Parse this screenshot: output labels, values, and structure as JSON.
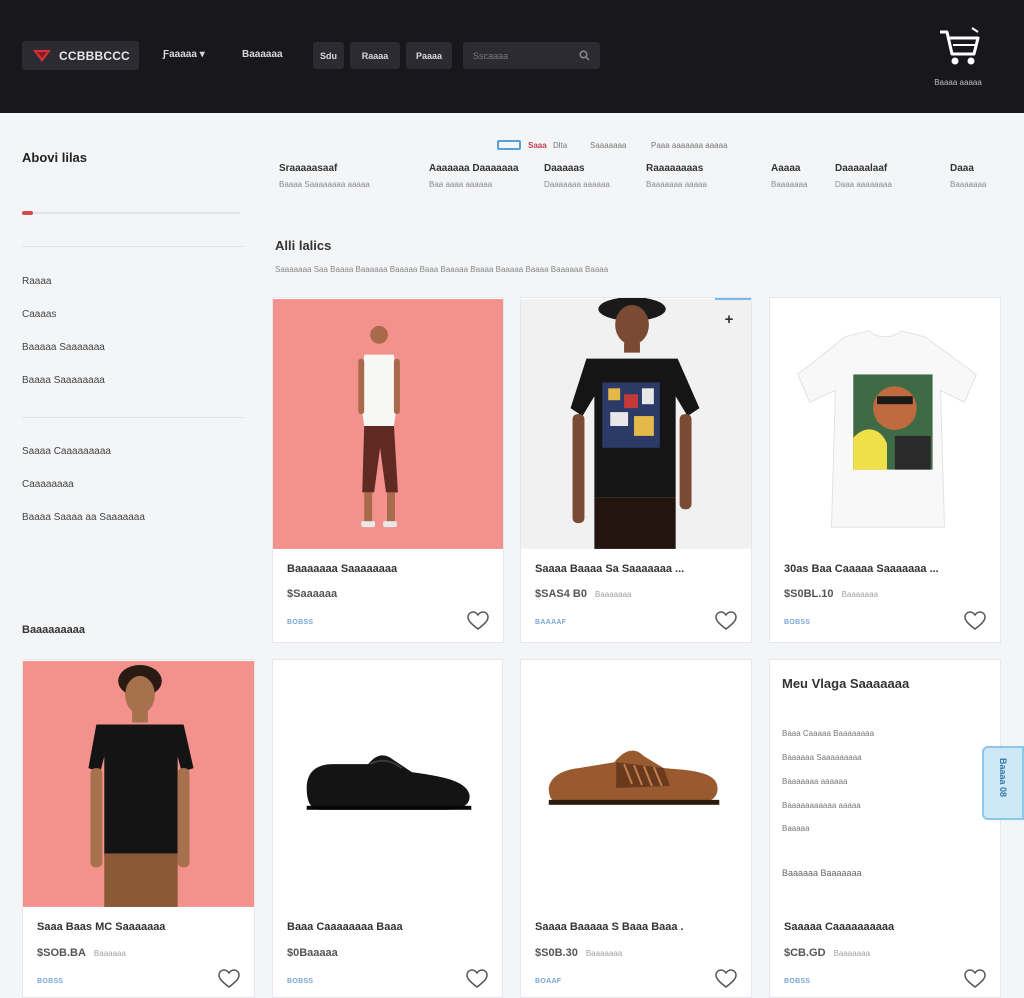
{
  "header": {
    "logo_text": "CCBBBCCC",
    "nav_links": [
      "Ƒaaaaa ▾",
      "Baaaaaa"
    ],
    "nav_buttons": [
      "Sdu",
      "Raaaa",
      "Paaaa"
    ],
    "search_placeholder": "Sscaaaa",
    "cart_label": "Baaaa aaaaa",
    "colors": {
      "bar": "#17171c",
      "accent": "#d24a4a"
    }
  },
  "sidebar": {
    "title": "Abovi lilas",
    "progress": 0.05,
    "group1": [
      "Raaaa",
      "Caaaas",
      "Baaaaa Saaaaaaa",
      "Baaaa Saaaaaaaa"
    ],
    "group2": [
      "Saaaa Caaaaaaaaa",
      "Caaaaaaaa",
      "Baaaa Saaaa aa Saaaaaaa"
    ],
    "heading": "Baaaaaaaaa"
  },
  "filters": {
    "top": [
      "Saaa",
      "Dlta",
      "Saaaaaaa",
      "Paaa  aaaaaaa aaaaa"
    ],
    "columns": [
      {
        "label": "Sraaaaasaaf",
        "sub": "Baaaa Saaaaaaaa aaaaa"
      },
      {
        "label": "Aaaaaaa Daaaaaaa",
        "sub": "Baa aaaa aaaaaa"
      },
      {
        "label": "Daaaaas",
        "sub": "Daaaaaaa aaaaaa"
      },
      {
        "label": "Raaaaaaaas",
        "sub": "Baaaaaaa aaaaa"
      },
      {
        "label": "Aaaaa",
        "sub": "Baaaaaaa"
      },
      {
        "label": "Daaaaalaaf",
        "sub": "Daaa aaaaaaaa"
      },
      {
        "label": "Daaa",
        "sub": "Baaaaaaa"
      }
    ]
  },
  "section": {
    "title": "Alli lalics",
    "description": "Saaaaaaa  Saa Baaaa Baaaaaa Baaaaa Baaa Baaaaa Baaaa Baaaaa Baaaa Baaaaaa Baaaa"
  },
  "products": [
    {
      "name": "Baaaaaaa Saaaaaaaa",
      "price": "$Saaaaaa",
      "old": "",
      "tag": "BOBSS",
      "bg": "#f3918d"
    },
    {
      "name": "Saaaa Baaaa Sa Saaaaaaa ...",
      "price": "$SAS4 B0",
      "old": "Baaaaaaa",
      "tag": "BAAAAF",
      "bg": "#f1f1f1"
    },
    {
      "name": "30as Baa Caaaaa Saaaaaaa ...",
      "price": "$S0BL.10",
      "old": "Baaaaaaa",
      "tag": "BOBSS",
      "bg": "#ffffff"
    },
    {
      "name": "Saaa Baas MC Saaaaaaa",
      "price": "$SOB.BA",
      "old": "Baaaaaa",
      "tag": "BOBSS",
      "bg": "#f3918d"
    },
    {
      "name": "Baaa Caaaaaaaa Baaa",
      "price": "$0Baaaaa",
      "old": "",
      "tag": "BOBSS",
      "bg": "#ffffff"
    },
    {
      "name": "Saaaa Baaaaa S Baaa Baaa .",
      "price": "$S0B.30",
      "old": "Baaaaaaa",
      "tag": "BOAAF",
      "bg": "#ffffff"
    },
    {
      "name": "Saaaaa Caaaaaaaaaa",
      "price": "$CB.GD",
      "old": "Baaaaaaa",
      "tag": "BOBSS",
      "bg": "#ffffff"
    }
  ],
  "info_card": {
    "title": "Meu Vlaga Saaaaaaa",
    "items": [
      "Baaa Caaaaa Baaaaaaaa",
      "Baaaaaa Saaaaaaaaa",
      "Baaaaaaa aaaaaa",
      "Baaaaaaaaaaa aaaaa",
      "Baaaaa"
    ],
    "footer": "Baaaaaa Baaaaaaa"
  },
  "float_tab": {
    "label": "Baaaa 08"
  }
}
